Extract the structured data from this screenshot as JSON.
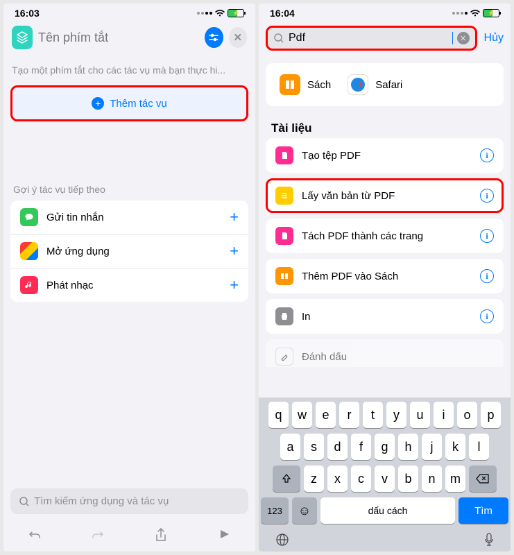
{
  "left": {
    "time": "16:03",
    "shortcut_title_placeholder": "Tên phím tắt",
    "description": "Tạo một phím tắt cho các tác vụ mà bạn thực hi...",
    "add_action_label": "Thêm tác vụ",
    "suggestions_title": "Gợi ý tác vụ tiếp theo",
    "suggestions": [
      {
        "label": "Gửi tin nhắn"
      },
      {
        "label": "Mở ứng dụng"
      },
      {
        "label": "Phát nhạc"
      }
    ],
    "search_placeholder": "Tìm kiếm ứng dụng và tác vụ"
  },
  "right": {
    "time": "16:04",
    "search_value": "Pdf",
    "cancel_label": "Hủy",
    "apps": [
      {
        "label": "Sách"
      },
      {
        "label": "Safari"
      }
    ],
    "documents_title": "Tài liệu",
    "actions": [
      {
        "label": "Tạo tệp PDF",
        "icon": "pink",
        "hl": false
      },
      {
        "label": "Lấy văn bản từ PDF",
        "icon": "yellow",
        "hl": true
      },
      {
        "label": "Tách PDF thành các trang",
        "icon": "pink",
        "hl": false
      },
      {
        "label": "Thêm PDF vào Sách",
        "icon": "orange",
        "hl": false
      },
      {
        "label": "In",
        "icon": "grey",
        "hl": false
      }
    ],
    "cutoff_label": "Đánh dấu",
    "keyboard": {
      "row1": [
        "q",
        "w",
        "e",
        "r",
        "t",
        "y",
        "u",
        "i",
        "o",
        "p"
      ],
      "row2": [
        "a",
        "s",
        "d",
        "f",
        "g",
        "h",
        "j",
        "k",
        "l"
      ],
      "row3": [
        "z",
        "x",
        "c",
        "v",
        "b",
        "n",
        "m"
      ],
      "numeric_key": "123",
      "space_label": "dấu cách",
      "return_label": "Tìm"
    }
  }
}
